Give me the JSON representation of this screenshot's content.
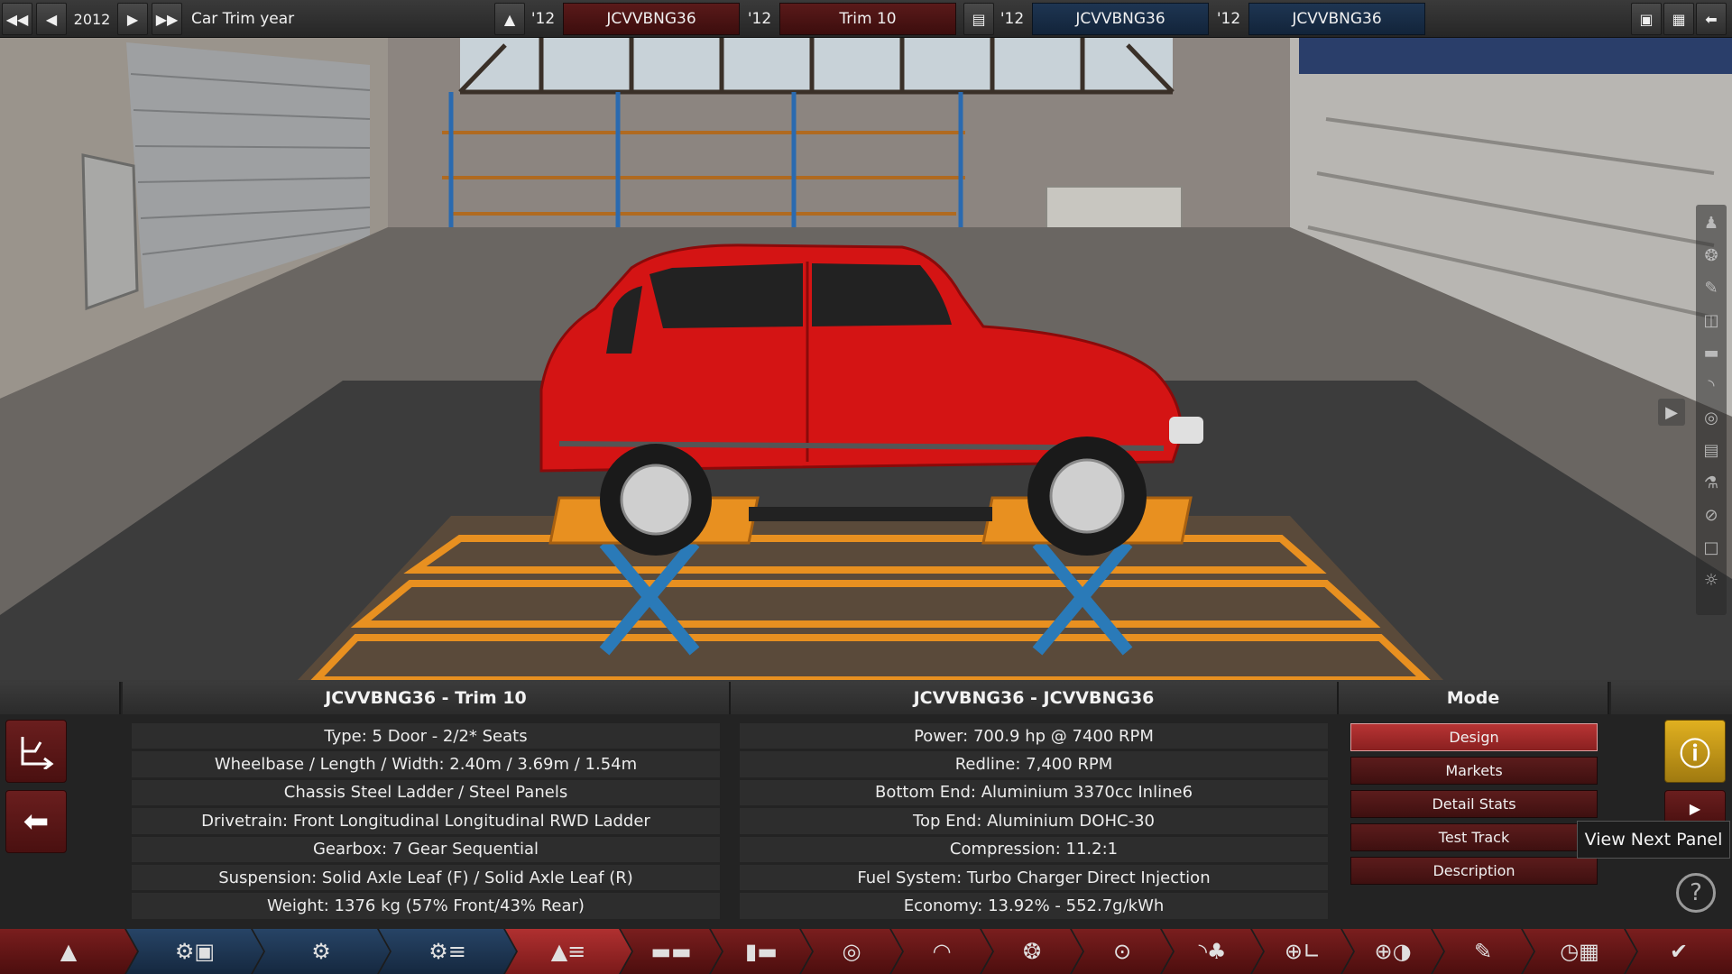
{
  "topbar": {
    "year": "2012",
    "title": "Car Trim year",
    "slots": [
      {
        "year": "'12",
        "label": "JCVVBNG36"
      },
      {
        "year": "'12",
        "label": "Trim 10"
      },
      {
        "year": "'12",
        "label": "JCVVBNG36"
      },
      {
        "year": "'12",
        "label": "JCVVBNG36"
      }
    ]
  },
  "panel": {
    "trim_title": "JCVVBNG36 - Trim 10",
    "trim_stats": [
      "Type: 5 Door - 2/2* Seats",
      "Wheelbase / Length / Width: 2.40m / 3.69m / 1.54m",
      "Chassis Steel Ladder / Steel Panels",
      "Drivetrain: Front Longitudinal Longitudinal RWD Ladder",
      "Gearbox: 7 Gear Sequential",
      "Suspension: Solid Axle Leaf (F) / Solid Axle Leaf (R)",
      "Weight: 1376 kg (57% Front/43% Rear)"
    ],
    "engine_title": "JCVVBNG36 - JCVVBNG36",
    "engine_stats": [
      "Power: 700.9 hp @ 7400 RPM",
      "Redline:  7,400 RPM",
      "Bottom End: Aluminium 3370cc Inline6",
      "Top End: Aluminium DOHC-30",
      "Compression: 11.2:1",
      "Fuel System: Turbo Charger Direct Injection",
      "Economy: 13.92% - 552.7g/kWh"
    ],
    "mode_title": "Mode",
    "modes": [
      "Design",
      "Markets",
      "Detail Stats",
      "Test Track",
      "Description"
    ],
    "tooltip": "View Next Panel"
  },
  "colors": {
    "accent_red": "#8a2020",
    "accent_blue": "#1e3552",
    "car_red": "#d41414",
    "lift_orange": "#e89020",
    "lift_blue": "#2a7ab8"
  },
  "icons": {
    "bottombar": [
      "car-body-icon",
      "engine-family-icon",
      "engine-icon",
      "engine-parts-icon",
      "chassis-icon",
      "car-models-icon",
      "drivetrain-icon",
      "suspension-icon",
      "gearbox-icon",
      "wheels-icon",
      "brakes-icon",
      "aero-icon",
      "interior-icon",
      "safety-icon",
      "fuel-icon",
      "test-icon",
      "finish-icon"
    ]
  }
}
